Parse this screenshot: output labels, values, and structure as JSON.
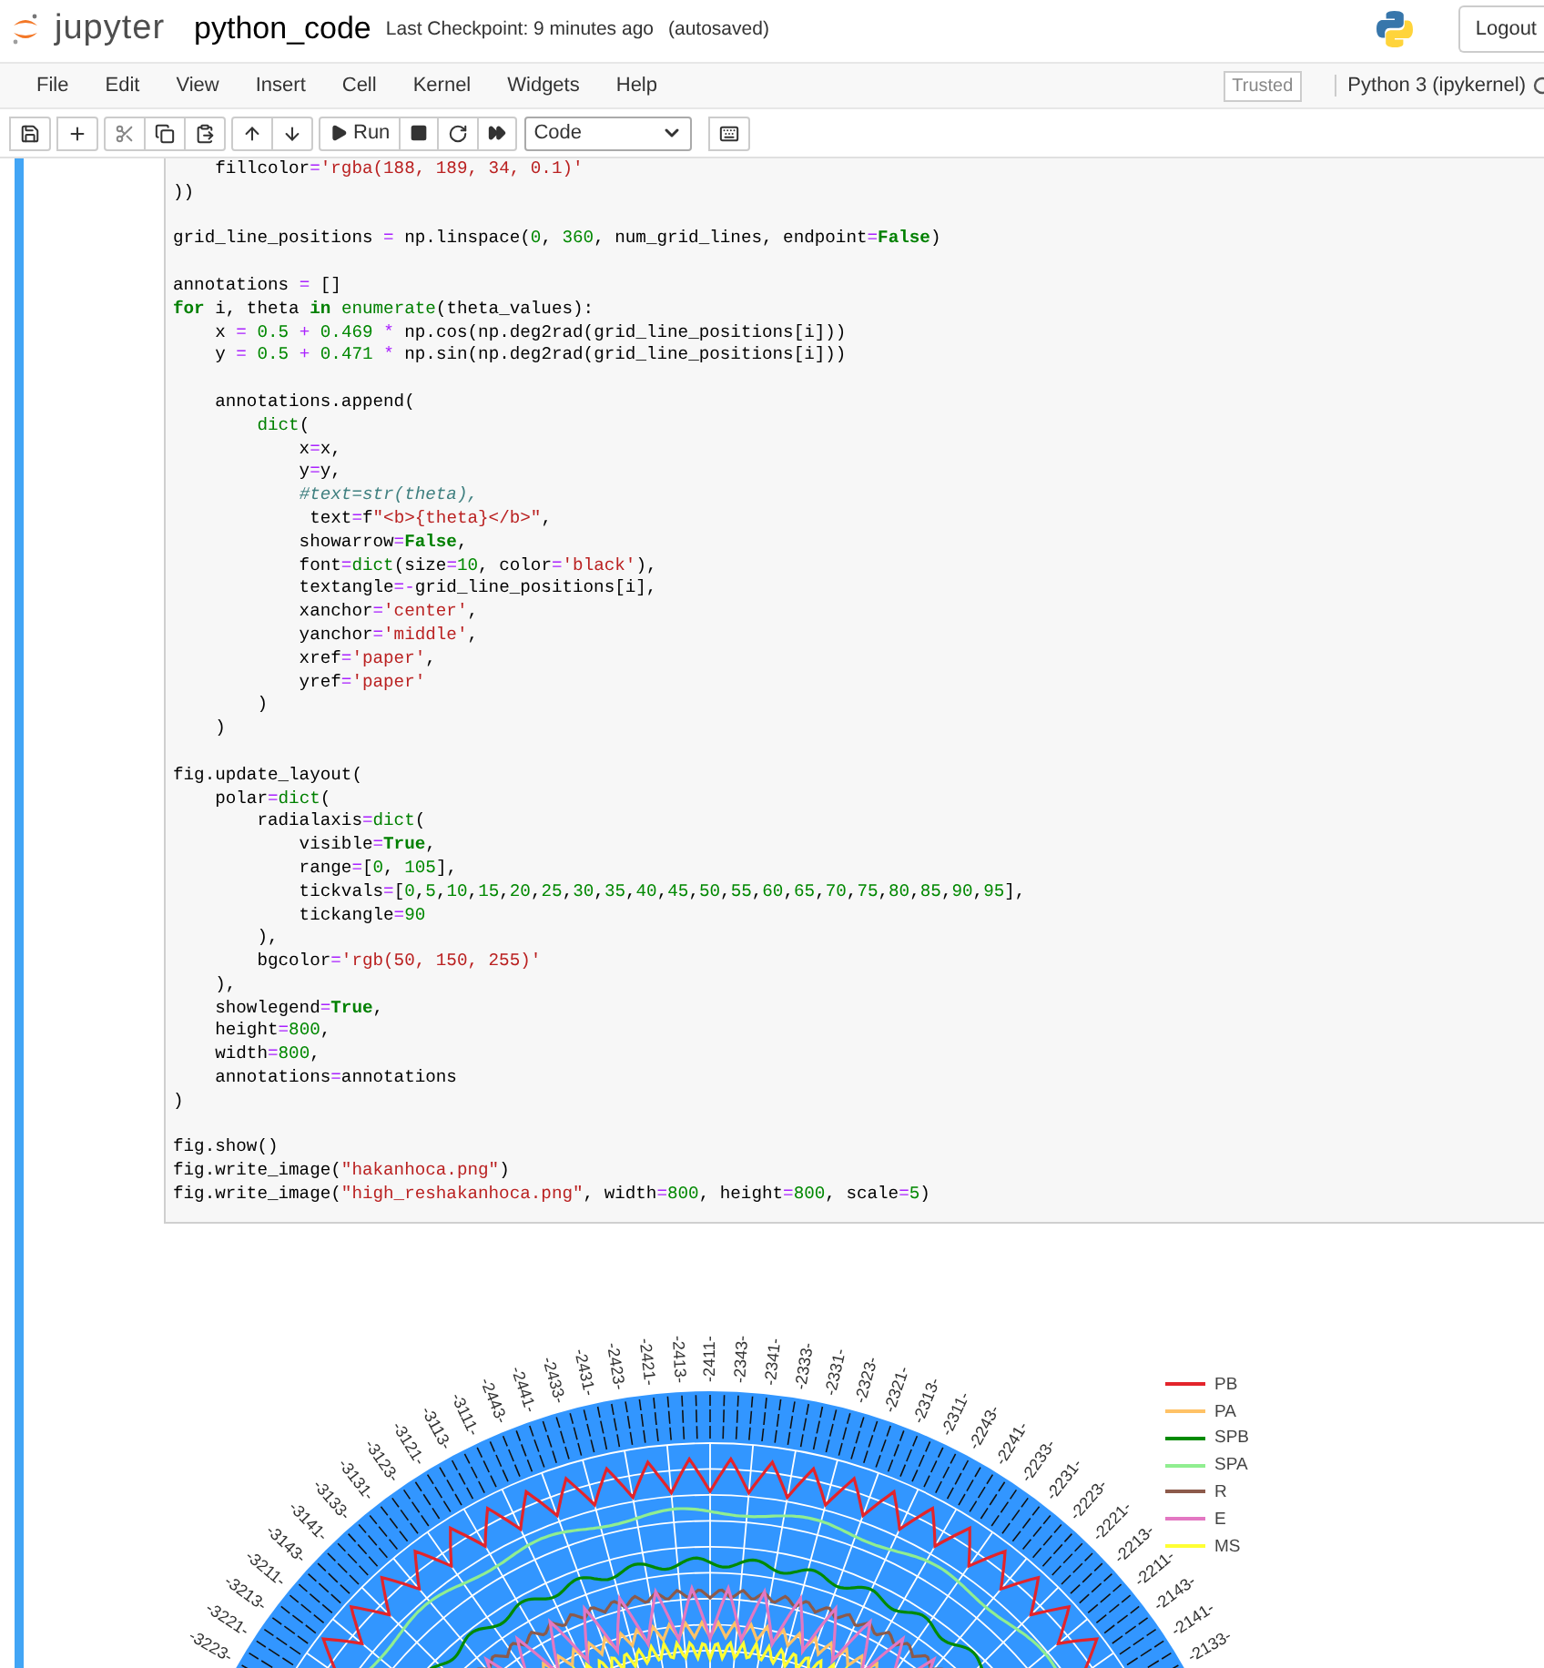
{
  "header": {
    "logo_text": "jupyter",
    "notebook_name": "python_code",
    "checkpoint": "Last Checkpoint: 9 minutes ago",
    "autosave": "(autosaved)",
    "logout": "Logout"
  },
  "menu": [
    "File",
    "Edit",
    "View",
    "Insert",
    "Cell",
    "Kernel",
    "Widgets",
    "Help"
  ],
  "trusted": "Trusted",
  "kernel": "Python 3 (ipykernel)",
  "toolbar": {
    "run": "Run",
    "cell_type": "Code"
  },
  "code_blocks": [
    [
      "    fillcolor='rgba(188, 189, 34, 0.1)'",
      "))"
    ],
    [
      "grid_line_positions = np.linspace(0, 360, num_grid_lines, endpoint=False)"
    ],
    [
      "annotations = []",
      "for i, theta in enumerate(theta_values):",
      "    x = 0.5 + 0.469 * np.cos(np.deg2rad(grid_line_positions[i]))",
      "    y = 0.5 + 0.471 * np.sin(np.deg2rad(grid_line_positions[i]))"
    ],
    [
      "    annotations.append(",
      "        dict(",
      "            x=x,",
      "            y=y,",
      "            #text=str(theta),",
      "             text=f\"<b>{theta}</b>\",",
      "            showarrow=False,",
      "            font=dict(size=10, color='black'),",
      "            textangle=-grid_line_positions[i],",
      "            xanchor='center',",
      "            yanchor='middle',",
      "            xref='paper',",
      "            yref='paper'",
      "        )",
      "    )"
    ],
    [
      "fig.update_layout(",
      "    polar=dict(",
      "        radialaxis=dict(",
      "            visible=True,",
      "            range=[0, 105],",
      "            tickvals=[0,5,10,15,20,25,30,35,40,45,50,55,60,65,70,75,80,85,90,95],",
      "            tickangle=90",
      "        ),",
      "        bgcolor='rgb(50, 150, 255)'",
      "    ),",
      "    showlegend=True,",
      "    height=800,",
      "    width=800,",
      "    annotations=annotations",
      ")"
    ],
    [
      "fig.show()",
      "fig.write_image(\"hakanhoca.png\")",
      "fig.write_image(\"high_reshakanhoca.png\", width=800, height=800, scale=5)"
    ]
  ],
  "angle_labels": [
    "-3223-",
    "-3221-",
    "-3213-",
    "-3211-",
    "-3143-",
    "-3141-",
    "-3133-",
    "-3131-",
    "-3123-",
    "-3121-",
    "-3113-",
    "-3111-",
    "-2443-",
    "-2441-",
    "-2433-",
    "-2431-",
    "-2423-",
    "-2421-",
    "-2413-",
    "-2411-",
    "-2343-",
    "-2341-",
    "-2333-",
    "-2331-",
    "-2323-",
    "-2321-",
    "-2313-",
    "-2311-",
    "-2243-",
    "-2241-",
    "-2233-",
    "-2231-",
    "-2223-",
    "-2221-",
    "-2213-",
    "-2211-",
    "-2143-",
    "-2141-",
    "-2133-"
  ],
  "legend": [
    {
      "name": "PB",
      "color": "#e3242b"
    },
    {
      "name": "PA",
      "color": "#ffc266"
    },
    {
      "name": "SPB",
      "color": "#008a00"
    },
    {
      "name": "SPA",
      "color": "#90ee90"
    },
    {
      "name": "R",
      "color": "#8c5a4b"
    },
    {
      "name": "E",
      "color": "#e377c2"
    },
    {
      "name": "MS",
      "color": "#ffff33"
    }
  ]
}
